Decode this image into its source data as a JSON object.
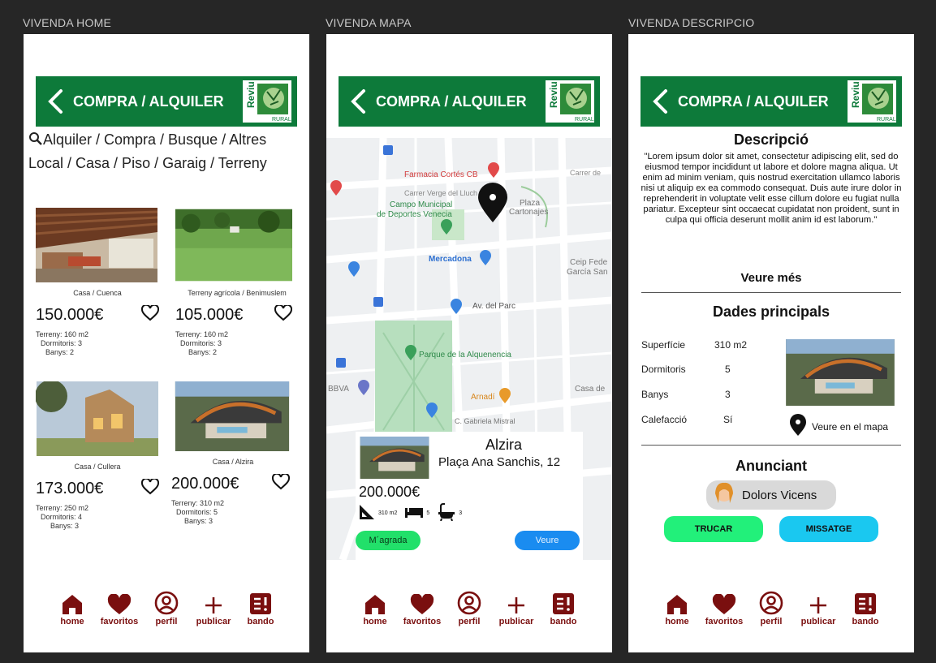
{
  "frames": {
    "home": "VIVENDA HOME",
    "map": "VIVENDA MAPA",
    "description": "VIVENDA DESCRIPCIO"
  },
  "header": {
    "title": "COMPRA / ALQUILER",
    "logo_top": "Reviu",
    "logo_bottom": "RURAL",
    "color": "#0d7a3a"
  },
  "nav": {
    "items": [
      {
        "label": "home",
        "icon": "home-icon"
      },
      {
        "label": "favoritos",
        "icon": "heart-icon"
      },
      {
        "label": "perfil",
        "icon": "user-icon"
      },
      {
        "label": "publicar",
        "icon": "plus-icon"
      },
      {
        "label": "bando",
        "icon": "notice-icon"
      }
    ],
    "color": "#7a0f0f"
  },
  "home": {
    "search_line1": "Alquiler / Compra / Busque / Altres",
    "search_line2": "Local / Casa / Piso / Garaig / Terreny",
    "cards": [
      {
        "caption": "Casa / Cuenca",
        "price": "150.000€",
        "specs": [
          "Terreny: 160 m2",
          "Dormitoris: 3",
          "Banys: 2"
        ]
      },
      {
        "caption": "Terreny agrícola / Benimuslem",
        "price": "105.000€",
        "specs": [
          "Terreny: 160 m2",
          "Dormitoris: 3",
          "Banys: 2"
        ]
      },
      {
        "caption": "Casa / Cullera",
        "price": "173.000€",
        "specs": [
          "Terreny: 250 m2",
          "Dormitoris: 4",
          "Banys: 3"
        ]
      },
      {
        "caption": "Casa / Alzira",
        "price": "200.000€",
        "specs": [
          "Terreny: 310 m2",
          "Dormitoris: 5",
          "Banys: 3"
        ]
      }
    ]
  },
  "map": {
    "labels": {
      "farmacia": "Farmacia Cortés CB",
      "carrer": "Carrer Verge del Lluch",
      "campo1": "Campo Municipal",
      "campo2": "de Deportes Venecia",
      "plaza1": "Plaza",
      "plaza2": "Cartonajes",
      "mercadona": "Mercadona",
      "ceip1": "Ceip Fede",
      "ceip2": "García San",
      "parc": "Av. del Parc",
      "alquenencia": "Parque de la Alquenencia",
      "bbva": "BBVA",
      "casa": "Casa de",
      "arnadi": "Arnadí",
      "gabriela": "C. Gabriela Mistral",
      "carrer_de": "Carrer de"
    },
    "listing": {
      "city": "Alzira",
      "address": "Plaça Ana Sanchis, 12",
      "price": "200.000€",
      "area": "310 m2",
      "beds": "5",
      "baths": "3",
      "like_label": "M´agrada",
      "view_label": "Veure"
    }
  },
  "description": {
    "title": "Descripció",
    "body": "\"Lorem ipsum dolor sit amet, consectetur adipiscing elit, sed do eiusmod tempor incididunt ut labore et dolore magna aliqua. Ut enim ad minim veniam, quis nostrud exercitation ullamco laboris nisi ut aliquip ex ea commodo consequat. Duis aute irure dolor in reprehenderit in voluptate velit esse cillum dolore eu fugiat nulla pariatur. Excepteur sint occaecat cupidatat non proident, sunt in culpa qui officia deserunt mollit anim id est laborum.\"",
    "more": "Veure més",
    "main_title": "Dades principals",
    "specs": [
      {
        "label": "Superfície",
        "value": "310 m2"
      },
      {
        "label": "Dormitoris",
        "value": "5"
      },
      {
        "label": "Banys",
        "value": "3"
      },
      {
        "label": "Calefacció",
        "value": "Sí"
      }
    ],
    "map_link": "Veure en el mapa",
    "advertiser_title": "Anunciant",
    "advertiser_name": "Dolors Vicens",
    "call_label": "TRUCAR",
    "message_label": "MISSATGE"
  }
}
